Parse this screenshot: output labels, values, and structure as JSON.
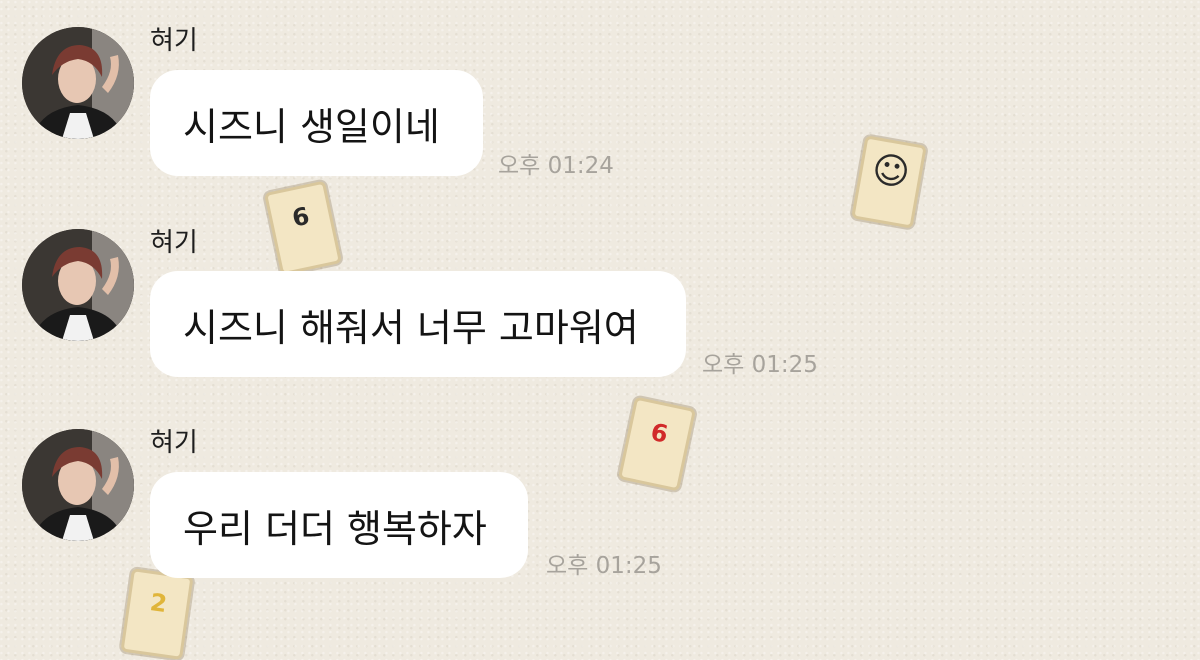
{
  "messages": [
    {
      "sender": "혀기",
      "text": "시즈니 생일이네",
      "time": "오후 01:24"
    },
    {
      "sender": "혀기",
      "text": "시즈니 해줘서 너무 고마워여",
      "time": "오후 01:25"
    },
    {
      "sender": "혀기",
      "text": "우리 더더 행복하자",
      "time": "오후 01:25"
    }
  ],
  "stickers": [
    {
      "glyph": "6",
      "color": "#2a2a2a"
    },
    {
      "glyph": "☺",
      "color": "#2a2a2a"
    },
    {
      "glyph": "6",
      "color": "#d12a2a"
    },
    {
      "glyph": "2",
      "color": "#e0b53a"
    }
  ],
  "colors": {
    "background": "#efeae0",
    "bubble": "#ffffff",
    "timestamp": "#a7a39c"
  }
}
